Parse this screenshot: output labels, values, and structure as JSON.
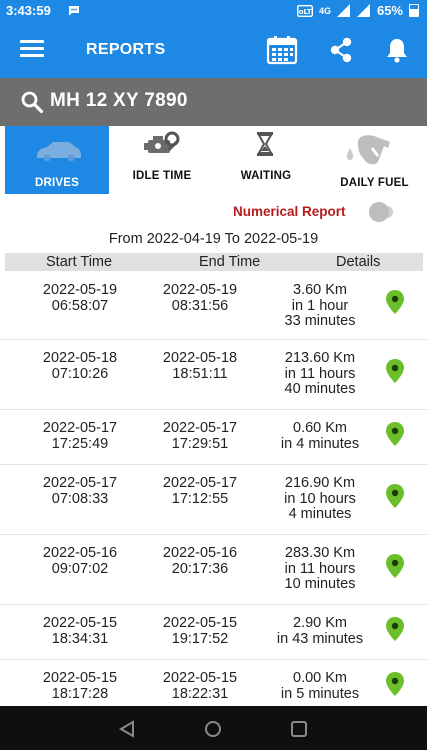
{
  "status_bar": {
    "time": "3:43:59",
    "network": "4G",
    "battery": "65%"
  },
  "app_bar": {
    "title": "REPORTS"
  },
  "search": {
    "value": "MH 12 XY 7890"
  },
  "tabs": [
    {
      "label": "DRIVES",
      "icon": "car-icon",
      "active": true
    },
    {
      "label": "IDLE TIME",
      "icon": "engine-gear-icon",
      "active": false
    },
    {
      "label": "WAITING",
      "icon": "hourglass-icon",
      "active": false
    },
    {
      "label": "DAILY FUEL",
      "icon": "fuel-nozzle-icon",
      "active": false
    }
  ],
  "numerical_report": {
    "label": "Numerical Report",
    "enabled": false
  },
  "range": "From 2022-04-19 To 2022-05-19",
  "columns": {
    "start": "Start Time",
    "end": "End Time",
    "details": "Details"
  },
  "accent_color": "#1e88e5",
  "pin_color": "#6abf2a",
  "rows": [
    {
      "start_date": "2022-05-19",
      "start_time": "06:58:07",
      "end_date": "2022-05-19",
      "end_time": "08:31:56",
      "distance": "3.60 Km",
      "duration_1": "in 1 hour",
      "duration_2": "33 minutes"
    },
    {
      "start_date": "2022-05-18",
      "start_time": "07:10:26",
      "end_date": "2022-05-18",
      "end_time": "18:51:11",
      "distance": "213.60 Km",
      "duration_1": "in 11 hours",
      "duration_2": "40 minutes"
    },
    {
      "start_date": "2022-05-17",
      "start_time": "17:25:49",
      "end_date": "2022-05-17",
      "end_time": "17:29:51",
      "distance": "0.60 Km",
      "duration_1": "in 4 minutes",
      "duration_2": ""
    },
    {
      "start_date": "2022-05-17",
      "start_time": "07:08:33",
      "end_date": "2022-05-17",
      "end_time": "17:12:55",
      "distance": "216.90 Km",
      "duration_1": "in 10 hours",
      "duration_2": "4 minutes"
    },
    {
      "start_date": "2022-05-16",
      "start_time": "09:07:02",
      "end_date": "2022-05-16",
      "end_time": "20:17:36",
      "distance": "283.30 Km",
      "duration_1": "in 11 hours",
      "duration_2": "10 minutes"
    },
    {
      "start_date": "2022-05-15",
      "start_time": "18:34:31",
      "end_date": "2022-05-15",
      "end_time": "19:17:52",
      "distance": "2.90 Km",
      "duration_1": "in 43 minutes",
      "duration_2": ""
    },
    {
      "start_date": "2022-05-15",
      "start_time": "18:17:28",
      "end_date": "2022-05-15",
      "end_time": "18:22:31",
      "distance": "0.00 Km",
      "duration_1": "in 5 minutes",
      "duration_2": ""
    }
  ]
}
